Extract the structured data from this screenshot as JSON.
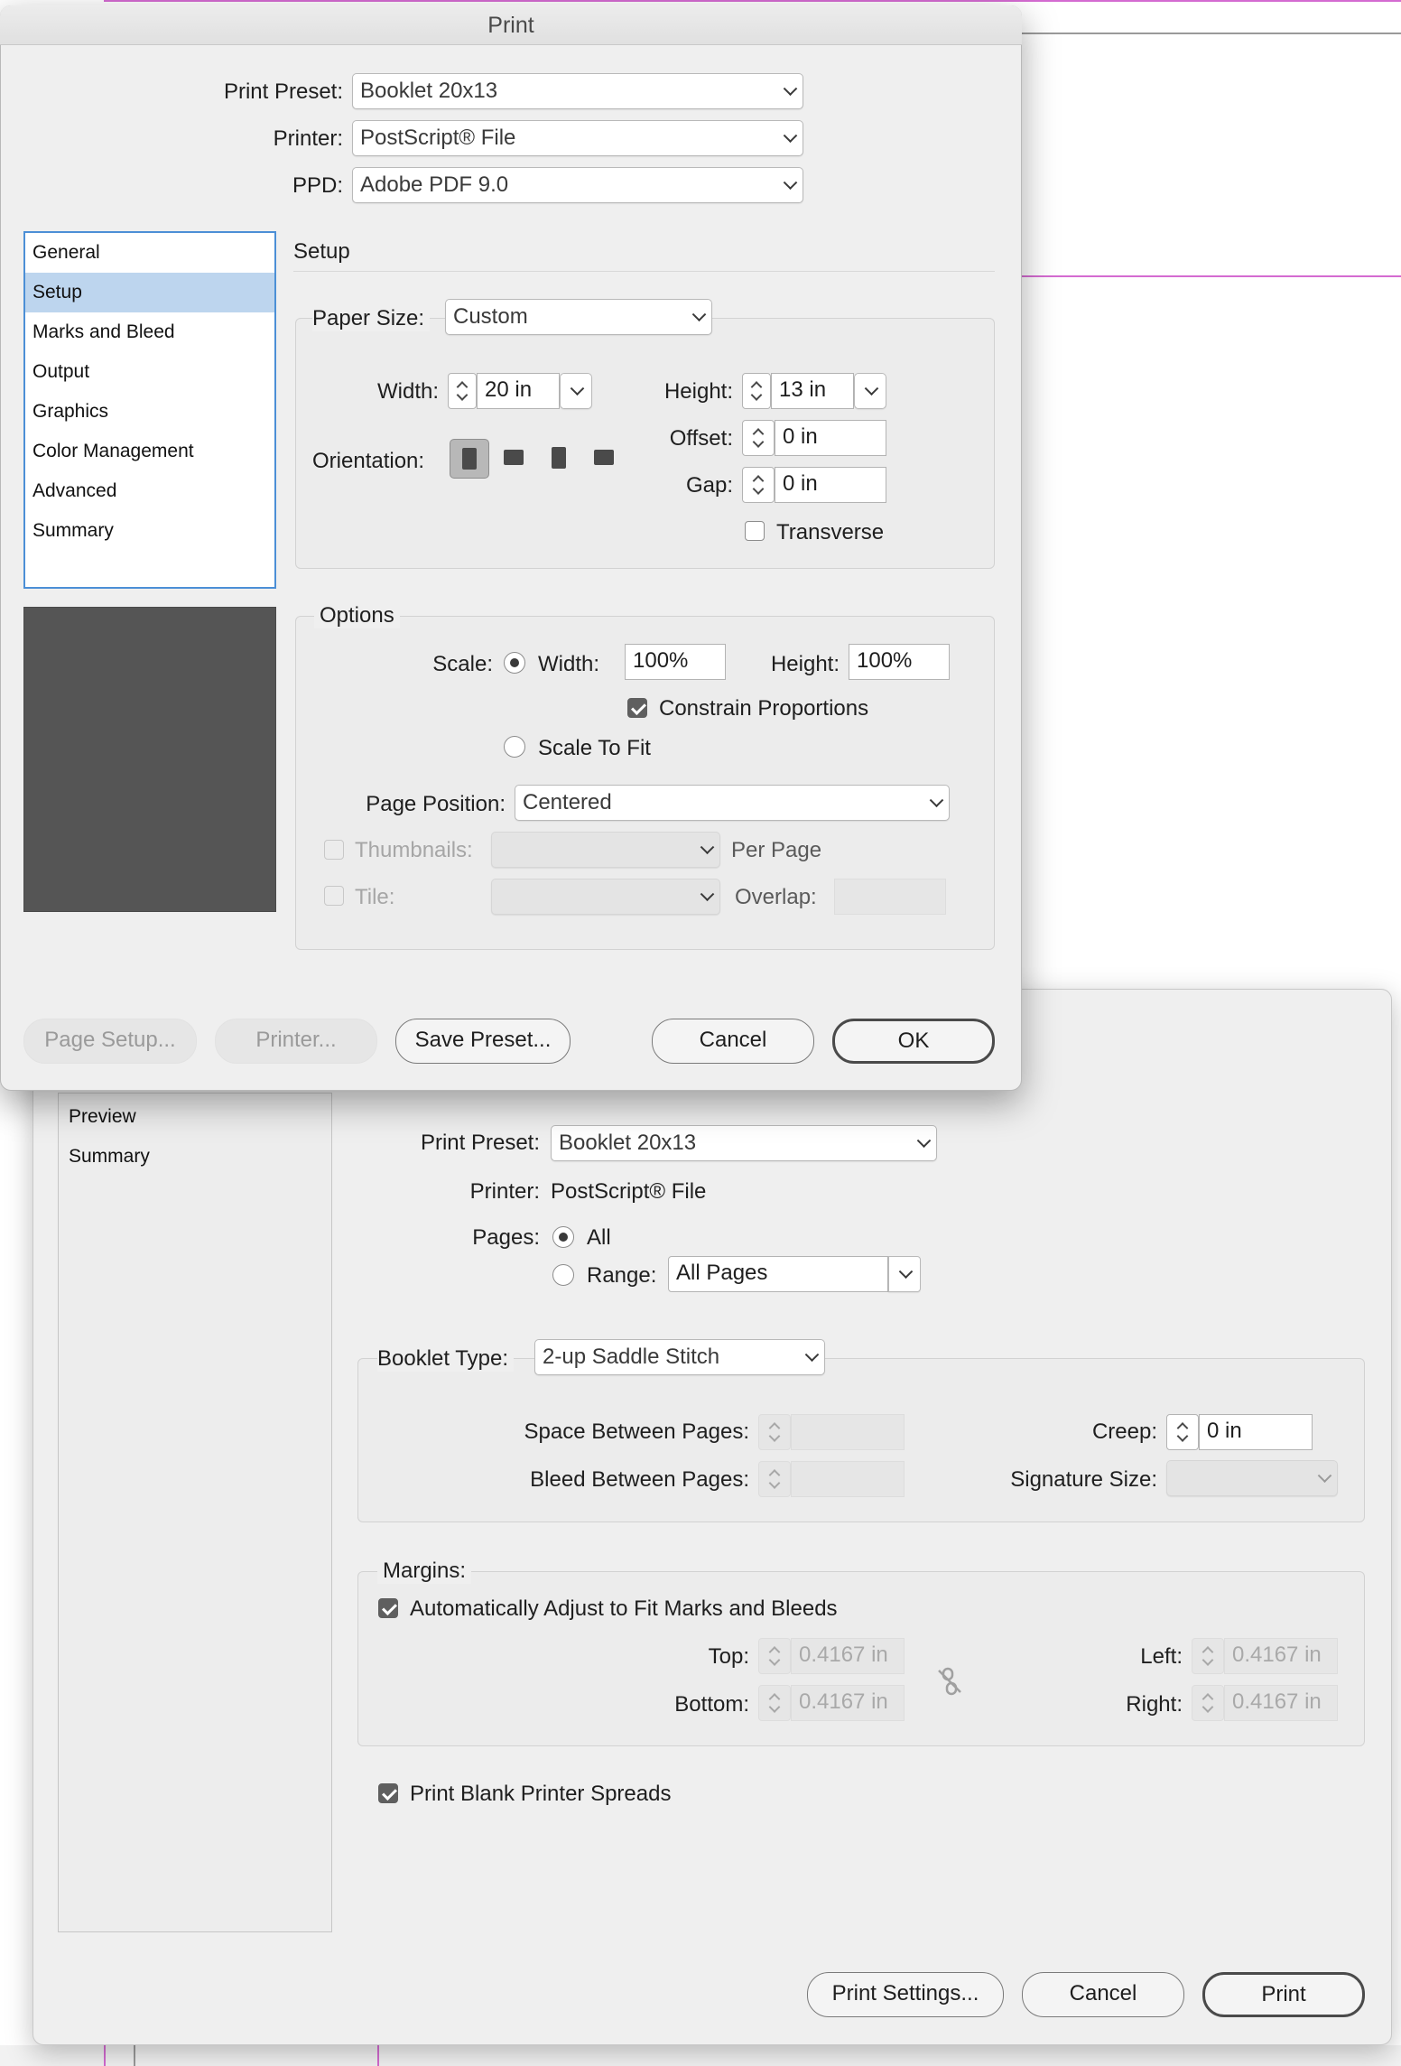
{
  "print_dialog": {
    "window_title": "Print",
    "print_preset": {
      "label": "Print Preset:",
      "value": "Booklet 20x13"
    },
    "printer": {
      "label": "Printer:",
      "value": "PostScript® File"
    },
    "ppd": {
      "label": "PPD:",
      "value": "Adobe PDF 9.0"
    },
    "categories": [
      "General",
      "Setup",
      "Marks and Bleed",
      "Output",
      "Graphics",
      "Color Management",
      "Advanced",
      "Summary"
    ],
    "selected_category": "Setup",
    "section_title": "Setup",
    "paper": {
      "paper_size_label": "Paper Size:",
      "paper_size_value": "Custom",
      "width_label": "Width:",
      "width_value": "20 in",
      "height_label": "Height:",
      "height_value": "13 in",
      "offset_label": "Offset:",
      "offset_value": "0 in",
      "gap_label": "Gap:",
      "gap_value": "0 in",
      "orientation_label": "Orientation:",
      "transverse_label": "Transverse",
      "transverse_checked": false
    },
    "options": {
      "title": "Options",
      "scale_label": "Scale:",
      "width_label": "Width:",
      "width_value": "100%",
      "height_label": "Height:",
      "height_value": "100%",
      "constrain_label": "Constrain Proportions",
      "constrain_checked": true,
      "scale_to_fit_label": "Scale To Fit",
      "page_position_label": "Page Position:",
      "page_position_value": "Centered",
      "thumbnails_label": "Thumbnails:",
      "per_page_label": "Per Page",
      "tile_label": "Tile:",
      "overlap_label": "Overlap:"
    },
    "buttons": {
      "page_setup": "Page Setup...",
      "printer": "Printer...",
      "save_preset": "Save Preset...",
      "cancel": "Cancel",
      "ok": "OK"
    }
  },
  "booklet_dialog": {
    "sidebar_items": [
      "Preview",
      "Summary"
    ],
    "print_preset": {
      "label": "Print Preset:",
      "value": "Booklet 20x13"
    },
    "printer": {
      "label": "Printer:",
      "value": "PostScript® File"
    },
    "pages_label": "Pages:",
    "all_label": "All",
    "range_label": "Range:",
    "range_value": "All Pages",
    "booklet_type_label": "Booklet Type:",
    "booklet_type_value": "2-up Saddle Stitch",
    "space_between_label": "Space Between Pages:",
    "bleed_between_label": "Bleed Between Pages:",
    "creep_label": "Creep:",
    "creep_value": "0 in",
    "signature_size_label": "Signature Size:",
    "margins": {
      "title": "Margins:",
      "auto_adjust_label": "Automatically Adjust to Fit Marks and Bleeds",
      "auto_adjust_checked": true,
      "top_label": "Top:",
      "top_value": "0.4167 in",
      "bottom_label": "Bottom:",
      "bottom_value": "0.4167 in",
      "left_label": "Left:",
      "left_value": "0.4167 in",
      "right_label": "Right:",
      "right_value": "0.4167 in"
    },
    "print_blank_label": "Print Blank Printer Spreads",
    "print_blank_checked": true,
    "buttons": {
      "print_settings": "Print Settings...",
      "cancel": "Cancel",
      "print": "Print"
    }
  },
  "colors": {
    "accent_selection": "#bdd5ee",
    "focus_ring": "#4c8fd6",
    "guide": "#d46bd1",
    "dialog_bg": "#efefef"
  }
}
